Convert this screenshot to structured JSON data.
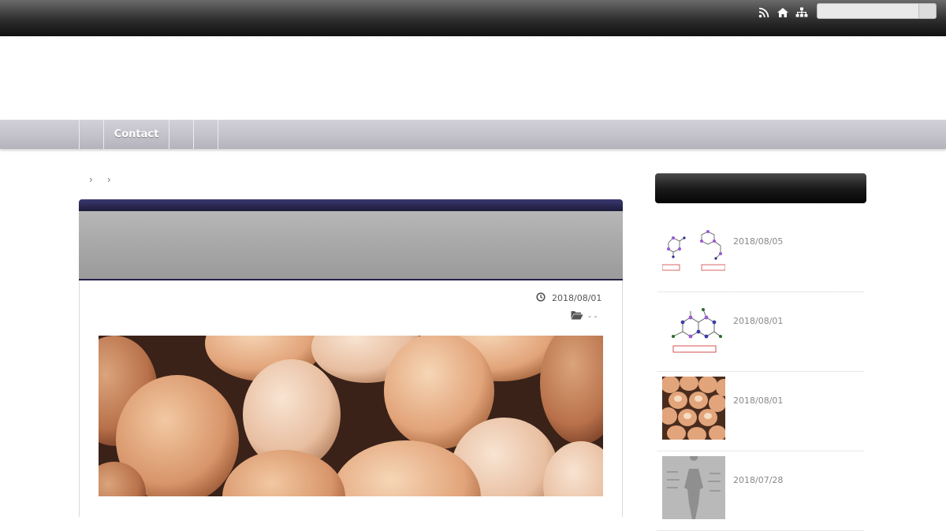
{
  "topbar": {
    "icons": [
      "rss-icon",
      "home-icon",
      "sitemap-icon"
    ],
    "search": {
      "placeholder": "",
      "value": ""
    }
  },
  "nav": {
    "items": [
      {
        "label": ""
      },
      {
        "label": "Contact"
      },
      {
        "label": ""
      },
      {
        "label": ""
      }
    ]
  },
  "breadcrumb": {
    "separators": [
      "›",
      "›"
    ]
  },
  "article": {
    "date": "2018/08/01",
    "category": "-  -"
  },
  "sidebar": {
    "recent": [
      {
        "date": "2018/08/05",
        "thumb": "molecule-diagrams"
      },
      {
        "date": "2018/08/01",
        "thumb": "molecule-diagram"
      },
      {
        "date": "2018/08/01",
        "thumb": "eggs-photo"
      },
      {
        "date": "2018/07/28",
        "thumb": "anatomy-chart"
      }
    ]
  },
  "colors": {
    "topbar": "#1a1a1a",
    "nav": "#c3c1ca",
    "article_accent": "#232148",
    "article_header": "#a8a8a8",
    "sidebar_header": "#111111"
  }
}
